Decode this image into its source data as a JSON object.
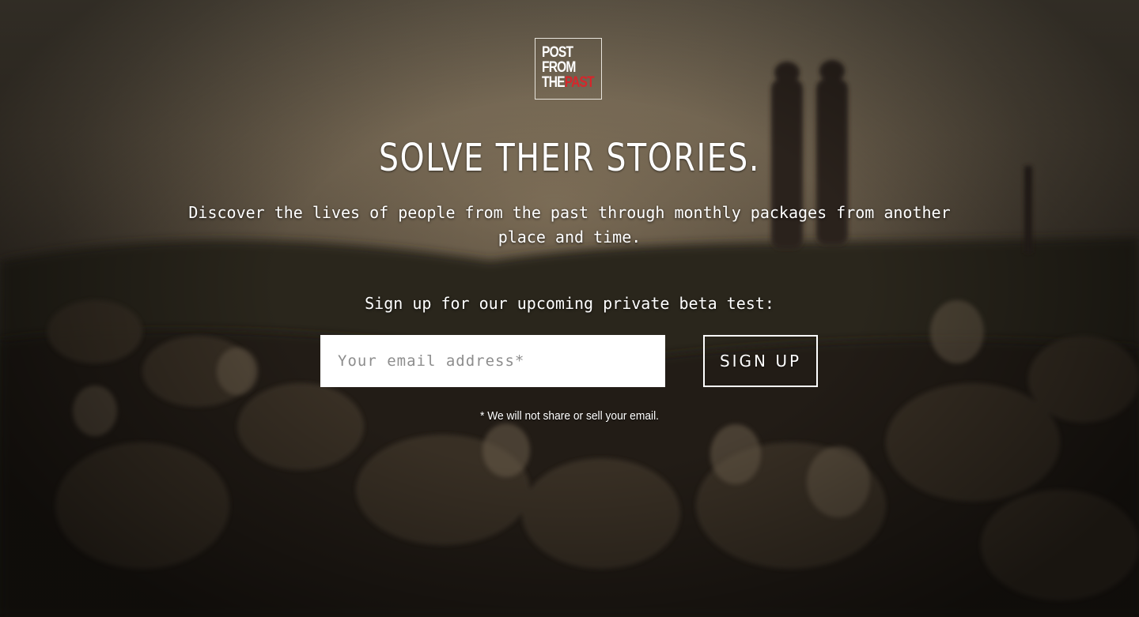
{
  "logo": {
    "line1": "POST",
    "line2": "FROM",
    "line3_white": "THE",
    "line3_red": "PAST"
  },
  "hero": {
    "headline": "SOLVE THEIR STORIES.",
    "subtext": "Discover the lives of people from the past through monthly packages from another place and time.",
    "signup_prompt": "Sign up for our upcoming private beta test:"
  },
  "form": {
    "email_placeholder": "Your email address*",
    "email_value": "",
    "submit_label": "SIGN UP",
    "disclaimer": "* We will not share or sell your email."
  },
  "colors": {
    "brand_red": "#d6262b",
    "text": "#ffffff",
    "background_tone": "#3f372d"
  }
}
